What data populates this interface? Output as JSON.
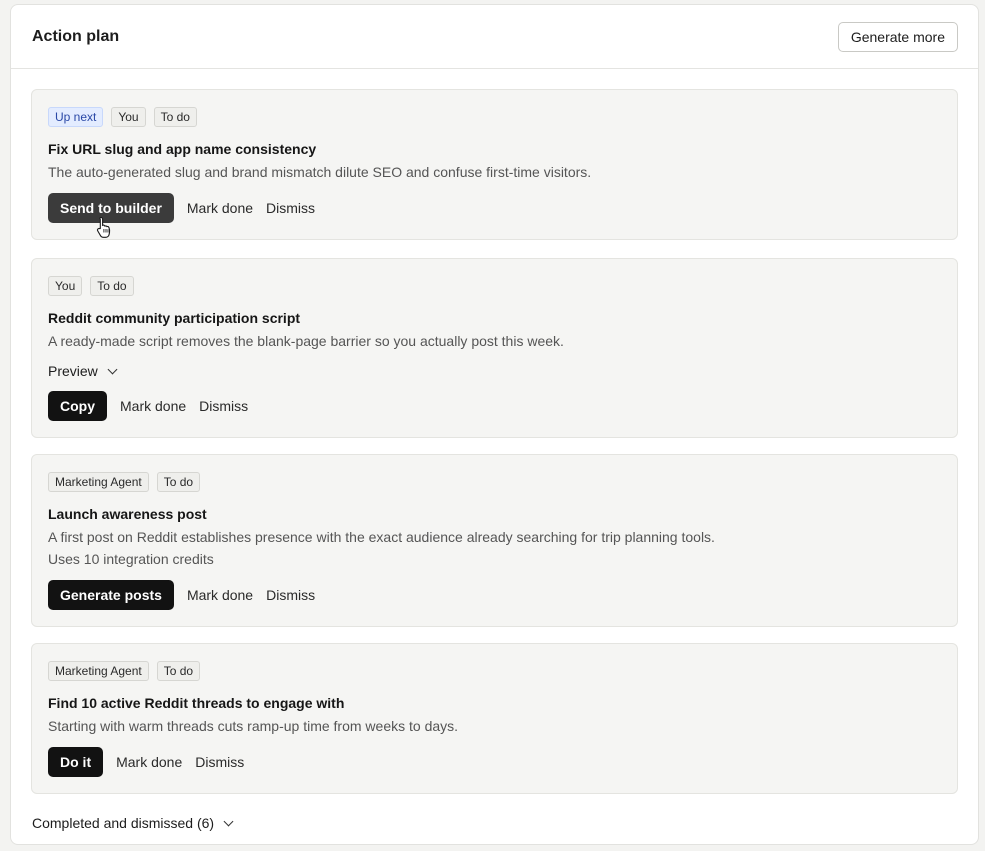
{
  "panel": {
    "title": "Action plan",
    "generate_more_label": "Generate more"
  },
  "cards": [
    {
      "tags": [
        "Up next",
        "You",
        "To do"
      ],
      "title": "Fix URL slug and app name consistency",
      "description": "The auto-generated slug and brand mismatch dilute SEO and confuse first-time visitors.",
      "primary_label": "Send to builder",
      "mark_done_label": "Mark done",
      "dismiss_label": "Dismiss"
    },
    {
      "tags": [
        "You",
        "To do"
      ],
      "title": "Reddit community participation script",
      "description": "A ready-made script removes the blank-page barrier so you actually post this week.",
      "preview_label": "Preview",
      "primary_label": "Copy",
      "mark_done_label": "Mark done",
      "dismiss_label": "Dismiss"
    },
    {
      "tags": [
        "Marketing Agent",
        "To do"
      ],
      "title": "Launch awareness post",
      "description": "A first post on Reddit establishes presence with the exact audience already searching for trip planning tools.",
      "note": "Uses 10 integration credits",
      "primary_label": "Generate posts",
      "mark_done_label": "Mark done",
      "dismiss_label": "Dismiss"
    },
    {
      "tags": [
        "Marketing Agent",
        "To do"
      ],
      "title": "Find 10 active Reddit threads to engage with",
      "description": "Starting with warm threads cuts ramp-up time from weeks to days.",
      "primary_label": "Do it",
      "mark_done_label": "Mark done",
      "dismiss_label": "Dismiss"
    }
  ],
  "footer": {
    "completed_label": "Completed and dismissed (6)"
  },
  "colors": {
    "up_next_tag_bg": "#e3ecff",
    "primary_button_bg": "#121212",
    "primary_button_hover_bg": "#3b3b3b"
  },
  "icons": [
    "chevron-down-icon",
    "hand-pointer-cursor-icon"
  ]
}
